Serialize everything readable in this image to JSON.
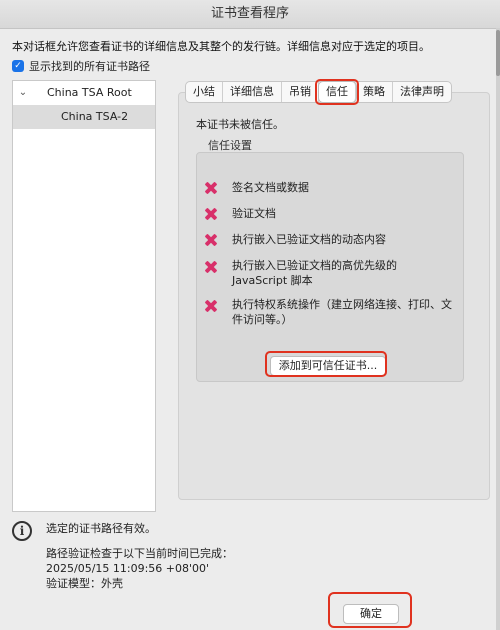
{
  "window": {
    "title": "证书查看程序"
  },
  "description": "本对话框允许您查看证书的详细信息及其整个的发行链。详细信息对应于选定的项目。",
  "show_all_paths": {
    "label": "显示找到的所有证书路径",
    "checked": true
  },
  "tree": {
    "root": "China TSA Root",
    "child": "China TSA-2"
  },
  "tabs": [
    "小结",
    "详细信息",
    "吊销",
    "信任",
    "策略",
    "法律声明"
  ],
  "selected_tab": "信任",
  "trust": {
    "status": "本证书未被信任。",
    "settings_label": "信任设置",
    "items": [
      "签名文档或数据",
      "验证文档",
      "执行嵌入已验证文档的动态内容",
      "执行嵌入已验证文档的高优先级的 JavaScript 脚本",
      "执行特权系统操作（建立网络连接、打印、文件访问等。）"
    ],
    "add_button": "添加到可信任证书..."
  },
  "footer": {
    "valid_text": "选定的证书路径有效。",
    "check_line1": "路径验证检查于以下当前时间已完成：",
    "check_time": "2025/05/15 11:09:56 +08'00'",
    "model": "验证模型：外壳",
    "ok_button": "确定"
  },
  "colors": {
    "highlight": "#e0321f",
    "denied_icon": "#d8306a",
    "checkbox": "#1a73e8"
  }
}
